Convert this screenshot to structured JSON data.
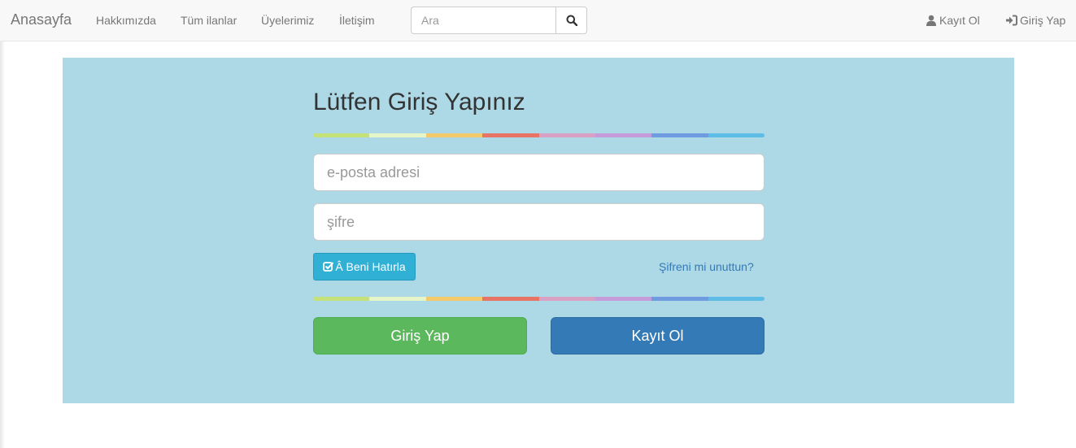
{
  "navbar": {
    "brand": "Anasayfa",
    "links": [
      "Hakkımızda",
      "Tüm ilanlar",
      "Üyelerimiz",
      "İletişim"
    ],
    "search": {
      "placeholder": "Ara",
      "button_icon": "search-icon"
    },
    "right_links": [
      {
        "label": "Kayıt Ol",
        "icon": "user-icon"
      },
      {
        "label": "Giriş Yap",
        "icon": "login-icon"
      }
    ]
  },
  "login": {
    "title": "Lütfen Giriş Yapınız",
    "email_placeholder": "e-posta adresi",
    "password_placeholder": "şifre",
    "remember_label": "Â Beni Hatırla",
    "remember_icon": "checkbox-icon",
    "forgot_label": "Şifreni mi unuttun?",
    "login_button": "Giriş Yap",
    "register_button": "Kayıt Ol"
  },
  "colors": {
    "panel_bg": "#add8e6",
    "rainbow": [
      "#c5e17a",
      "#e6f5c8",
      "#f3c969",
      "#e87465",
      "#d8a1c4",
      "#c59cd9",
      "#6f9be0",
      "#5ebde7"
    ],
    "success": "#5cb85c",
    "primary": "#337ab7",
    "info": "#31b0d5"
  }
}
